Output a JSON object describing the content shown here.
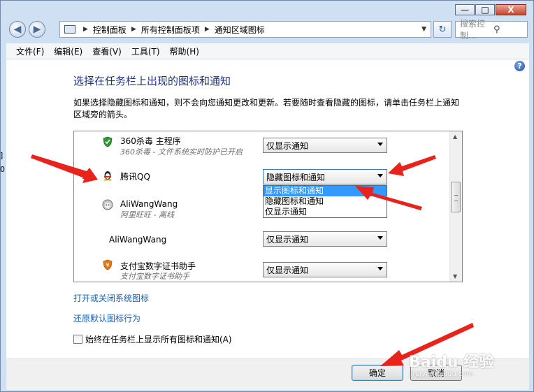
{
  "window": {
    "caption_buttons": {
      "minimize": "—",
      "maximize": "□",
      "close": "X"
    }
  },
  "nav": {
    "back_icon": "◀",
    "forward_icon": "▶",
    "breadcrumb": [
      "控制面板",
      "所有控制面板项",
      "通知区域图标"
    ],
    "refresh_icon": "↻",
    "search_placeholder": "搜索控制...",
    "search_icon": "⚲"
  },
  "menu": [
    "文件(F)",
    "编辑(E)",
    "查看(V)",
    "工具(T)",
    "帮助(H)"
  ],
  "page": {
    "title": "选择在任务栏上出现的图标和通知",
    "description": "如果选择隐藏图标和通知，则不会向您通知更改和更新。若要随时查看隐藏的图标，请单击任务栏上通知区域旁的箭头。",
    "help_label": "?"
  },
  "apps": [
    {
      "name": "360杀毒 主程序",
      "sub": "360杀毒 - 文件系统实时防护已开启",
      "behavior": "仅显示通知",
      "icon": "shield-icon"
    },
    {
      "name": "腾讯QQ",
      "sub": "",
      "behavior": "隐藏图标和通知",
      "icon": "qq-penguin-icon"
    },
    {
      "name": "AliWangWang",
      "sub": "阿里旺旺 - 离线",
      "behavior": "",
      "icon": "aliwangwang-icon"
    },
    {
      "name": "AliWangWang",
      "sub": "",
      "behavior": "仅显示通知",
      "icon": ""
    },
    {
      "name": "支付宝数字证书助手",
      "sub": "支付宝数字证书助手",
      "behavior": "仅显示通知",
      "icon": "alipay-cert-icon"
    }
  ],
  "dropdown_options": [
    "显示图标和通知",
    "隐藏图标和通知",
    "仅显示通知"
  ],
  "dropdown_selected_index": 0,
  "links": {
    "system_icons": "打开或关闭系统图标",
    "restore_default": "还原默认图标行为"
  },
  "checkbox": {
    "label": "始终在任务栏上显示所有图标和通知(A)",
    "checked": false
  },
  "buttons": {
    "ok": "确定",
    "cancel": "取消"
  },
  "watermark": {
    "text": "Baidu 经验",
    "sub": "jingyan.baidu.com"
  },
  "left_edge_glyphs": [
    "]",
    "0"
  ],
  "colors": {
    "title": "#1e3287",
    "link": "#1a5fb4",
    "annotation_arrow": "#e8231b",
    "selection": "#3399ff"
  }
}
